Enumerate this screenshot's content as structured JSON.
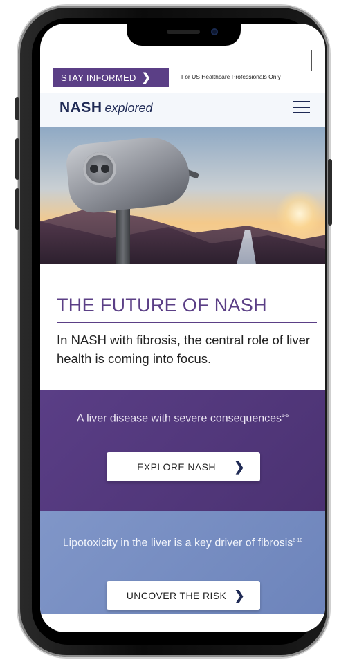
{
  "topbar": {
    "stay_label": "STAY INFORMED",
    "stay_chevron": "❯",
    "hcp_text": "For US Healthcare Professionals Only"
  },
  "header": {
    "logo_bold": "NASH",
    "logo_italic": "explored",
    "menu_icon": "hamburger-menu-icon"
  },
  "hero": {
    "image": "coin-operated-binoculars-over-canyon"
  },
  "main": {
    "title": "THE FUTURE OF NASH",
    "intro": "In NASH with fibrosis, the central role of liver health is coming into focus."
  },
  "section_disease": {
    "text": "A liver disease with severe consequences",
    "sup": "1-5",
    "button_label": "EXPLORE NASH",
    "button_chevron": "❯"
  },
  "section_risk": {
    "text": "Lipotoxicity in the liver is a key driver of fibrosis",
    "sup": "6-10",
    "button_label": "UNCOVER THE RISK",
    "button_chevron": "❯"
  },
  "colors": {
    "brand_purple": "#5b3f86",
    "brand_navy": "#1f2a55",
    "section_blue": "#7a90c4"
  }
}
